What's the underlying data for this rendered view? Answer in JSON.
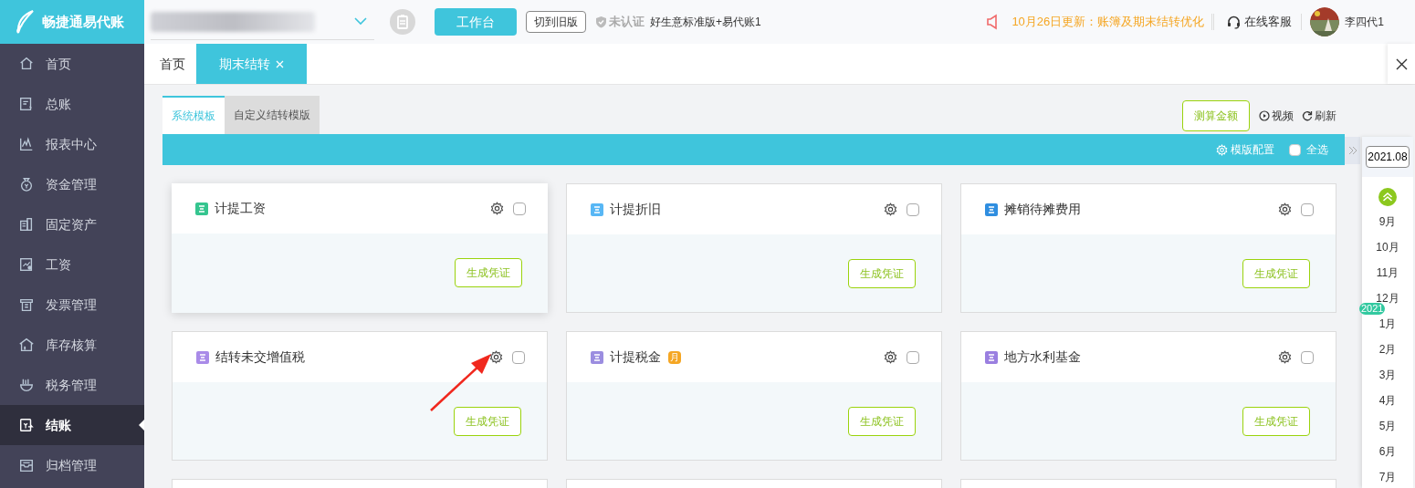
{
  "logo": {
    "text": "畅捷通易代账"
  },
  "sidebar": {
    "items": [
      {
        "label": "首页",
        "selected": false
      },
      {
        "label": "总账",
        "selected": false
      },
      {
        "label": "报表中心",
        "selected": false
      },
      {
        "label": "资金管理",
        "selected": false
      },
      {
        "label": "固定资产",
        "selected": false
      },
      {
        "label": "工资",
        "selected": false
      },
      {
        "label": "发票管理",
        "selected": false
      },
      {
        "label": "库存核算",
        "selected": false
      },
      {
        "label": "税务管理",
        "selected": false
      },
      {
        "label": "结账",
        "selected": true
      },
      {
        "label": "归档管理",
        "selected": false
      }
    ]
  },
  "topbar": {
    "workbench_button": "工作台",
    "switch_button": "切到旧版",
    "certification": "未认证",
    "edition": "好生意标准版+易代账1",
    "notice": "10月26日更新：账簿及期末结转优化",
    "support": "在线客服",
    "user": "李四代1"
  },
  "page_tabs": [
    {
      "label": "首页",
      "selected": false,
      "closable": false
    },
    {
      "label": "期末结转",
      "selected": true,
      "closable": true
    }
  ],
  "template_tabs": [
    {
      "label": "系统模板",
      "selected": true
    },
    {
      "label": "自定义结转模版",
      "selected": false
    }
  ],
  "actions": {
    "calculate": "测算金额",
    "video": "视频",
    "refresh": "刷新"
  },
  "toolbar": {
    "config": "模版配置",
    "select_all": {
      "label": "全选",
      "checked": false
    }
  },
  "cards": [
    {
      "kind": "template",
      "title": "计提工资",
      "color": "#35c58f",
      "highlighted": true,
      "checked": false,
      "button": "生成凭证"
    },
    {
      "kind": "template",
      "title": "计提折旧",
      "color": "#58b7f5",
      "highlighted": false,
      "checked": false,
      "button": "生成凭证"
    },
    {
      "kind": "template",
      "title": "摊销待摊费用",
      "color": "#2f8ee0",
      "highlighted": false,
      "checked": false,
      "button": "生成凭证"
    },
    {
      "kind": "template",
      "title": "结转未交增值税",
      "color": "#a98be8",
      "highlighted": false,
      "checked": false,
      "button": "生成凭证"
    },
    {
      "kind": "template",
      "title": "计提税金",
      "color": "#9b8de0",
      "highlighted": false,
      "checked": false,
      "button": "生成凭证",
      "badge": "月"
    },
    {
      "kind": "template",
      "title": "地方水利基金",
      "color": "#9a7fe0",
      "highlighted": false,
      "checked": false,
      "button": "生成凭证"
    },
    {
      "kind": "cut"
    },
    {
      "kind": "cut"
    },
    {
      "kind": "cut"
    }
  ],
  "period_panel": {
    "value": "2021.08",
    "months": [
      {
        "label": "9月"
      },
      {
        "label": "10月"
      },
      {
        "label": "11月"
      },
      {
        "label": "12月"
      },
      {
        "label": "1月",
        "year": "2021"
      },
      {
        "label": "2月"
      },
      {
        "label": "3月"
      },
      {
        "label": "4月"
      },
      {
        "label": "5月"
      },
      {
        "label": "6月"
      },
      {
        "label": "7月"
      }
    ]
  }
}
